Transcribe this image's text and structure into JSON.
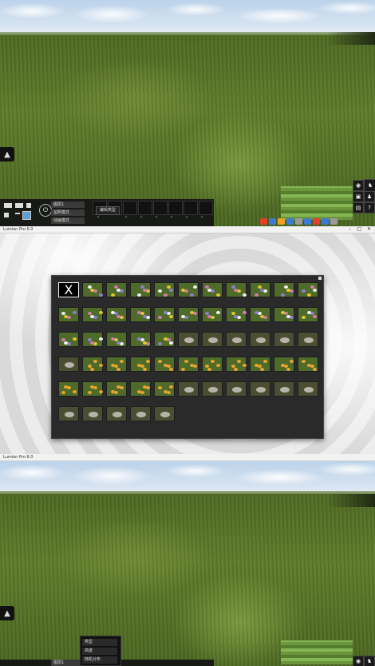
{
  "window": {
    "title": "Lumion Pro 6.0"
  },
  "viewer": {
    "buttons": {
      "layer": "图层1",
      "photo": "拍照模式",
      "movie": "动画模式",
      "edit": "编辑类型"
    }
  },
  "library": {
    "close_label": "X",
    "rows": [
      [
        "x",
        "flower",
        "flower",
        "flower",
        "flower",
        "flower",
        "flower",
        "flower",
        "flower",
        "flower",
        "flower"
      ],
      [
        "flower",
        "flower",
        "flower",
        "flower",
        "flower",
        "flower",
        "flower",
        "flower",
        "flower",
        "flower",
        "flower"
      ],
      [
        "flower",
        "flower",
        "flower",
        "flower",
        "flower",
        "rock",
        "rock",
        "rock",
        "rock",
        "rock",
        "rock"
      ],
      [
        "rock",
        "plant",
        "plant",
        "plant",
        "plant",
        "plant",
        "plant",
        "plant",
        "plant",
        "plant",
        "plant"
      ],
      [
        "plant",
        "plant",
        "plant",
        "plant",
        "plant",
        "rock",
        "rock",
        "rock",
        "rock",
        "rock",
        "rock"
      ],
      [
        "rock",
        "rock",
        "rock",
        "rock",
        "rock"
      ]
    ]
  },
  "context_menu": {
    "items": [
      "类型",
      "高度",
      "随机分布"
    ]
  },
  "colors": {
    "toolbar": "#141414",
    "panel": "#2a2a2a",
    "grass": "#5f7d2a",
    "sky": "#c9dcee",
    "yellow_flower": "#e0c832",
    "white_flower": "#f2f2f2",
    "pink_flower": "#d47ab0",
    "purple_flower": "#8f7fd0",
    "rock": "#b8b3a8"
  }
}
